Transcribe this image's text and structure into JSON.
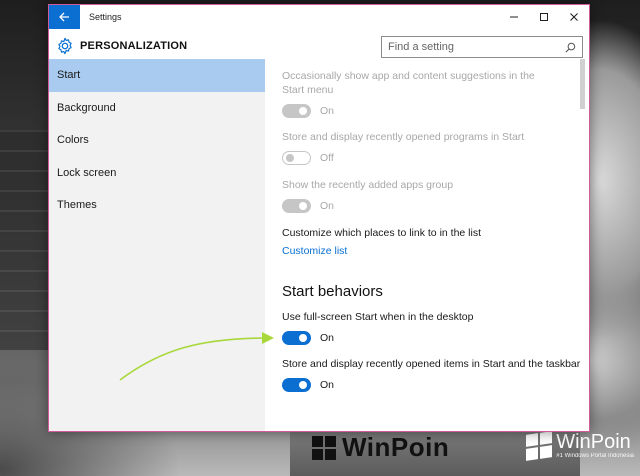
{
  "window": {
    "title": "Settings"
  },
  "header": {
    "title": "PERSONALIZATION",
    "search_placeholder": "Find a setting"
  },
  "sidebar": {
    "items": [
      {
        "label": "Start",
        "selected": true
      },
      {
        "label": "Background",
        "selected": false
      },
      {
        "label": "Colors",
        "selected": false
      },
      {
        "label": "Lock screen",
        "selected": false
      },
      {
        "label": "Themes",
        "selected": false
      }
    ]
  },
  "content": {
    "settings": [
      {
        "label": "Occasionally show app and content suggestions in the Start menu",
        "state": "On",
        "enabled": false
      },
      {
        "label": "Store and display recently opened programs in Start",
        "state": "Off",
        "enabled": false
      },
      {
        "label": "Show the recently added apps group",
        "state": "On",
        "enabled": false
      }
    ],
    "customize": {
      "label": "Customize which places to link to in the list",
      "link": "Customize list"
    },
    "section_heading": "Start behaviors",
    "behaviors": [
      {
        "label": "Use full-screen Start when in the desktop",
        "state": "On",
        "enabled": true
      },
      {
        "label": "Store and display recently opened items in Start and the taskbar",
        "state": "On",
        "enabled": true
      }
    ]
  },
  "watermark": {
    "center_text": "WinPoin",
    "corner_text": "WinPoin",
    "corner_tagline": "#1 Windows Portal Indonesia"
  },
  "colors": {
    "accent": "#0a6fd1",
    "selected_nav": "#a9cbef",
    "annotation_arrow": "#a8d83a"
  }
}
